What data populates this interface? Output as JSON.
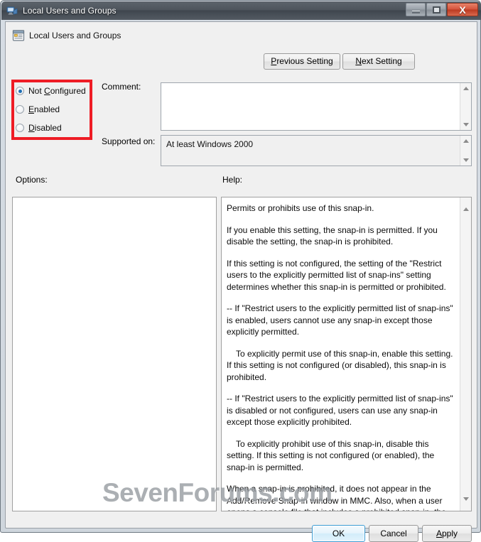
{
  "window": {
    "title": "Local Users and Groups",
    "title_icon": "mmc-snapin-icon",
    "controls": {
      "minimize_label": "Minimize",
      "maximize_label": "Maximize",
      "close_label": "X"
    }
  },
  "header": {
    "setting_name": "Local Users and Groups",
    "icon": "policy-setting-icon",
    "previous_button": "Previous Setting",
    "previous_accesskey": "P",
    "next_button": "Next Setting",
    "next_accesskey": "N"
  },
  "state": {
    "options": [
      {
        "label": "Not Configured",
        "accesskey": "C",
        "prefix": "Not ",
        "suffix": "onfigured",
        "selected": true
      },
      {
        "label": "Enabled",
        "accesskey": "E",
        "prefix": "",
        "suffix": "nabled",
        "selected": false
      },
      {
        "label": "Disabled",
        "accesskey": "D",
        "prefix": "",
        "suffix": "isabled",
        "selected": false
      }
    ],
    "highlight_color": "#ee1c25"
  },
  "comment": {
    "label": "Comment:",
    "value": "",
    "placeholder": ""
  },
  "supported": {
    "label": "Supported on:",
    "value": "At least Windows 2000"
  },
  "panels": {
    "options_label": "Options:",
    "help_label": "Help:",
    "options_content": ""
  },
  "help": {
    "paragraphs": [
      {
        "text": "Permits or prohibits use of this snap-in.",
        "indent": false
      },
      {
        "text": "If you enable this setting, the snap-in is permitted. If you disable the setting, the snap-in is prohibited.",
        "indent": false
      },
      {
        "text": "If this setting is not configured, the setting of the \"Restrict users to the explicitly permitted list of snap-ins\" setting determines whether this snap-in is permitted or prohibited.",
        "indent": false
      },
      {
        "text": "-- If \"Restrict users to the explicitly permitted list of snap-ins\" is enabled, users cannot use any snap-in except those explicitly permitted.",
        "indent": false
      },
      {
        "text": "To explicitly permit use of this snap-in, enable this setting. If this setting is not configured (or disabled), this snap-in is prohibited.",
        "indent": true
      },
      {
        "text": "-- If \"Restrict users to the explicitly permitted list of snap-ins\" is disabled or not configured, users can use any snap-in except those explicitly prohibited.",
        "indent": false
      },
      {
        "text": "To explicitly prohibit use of this snap-in, disable this setting. If this setting is not configured (or enabled), the snap-in is permitted.",
        "indent": true
      },
      {
        "text": "When a snap-in is prohibited, it does not appear in the Add/Remove Snap-in window in MMC. Also, when a user opens a console file that includes a prohibited snap-in, the console file opens, but the prohibited snap-in does not appear.",
        "indent": false
      }
    ]
  },
  "footer": {
    "ok": "OK",
    "cancel": "Cancel",
    "apply": "Apply",
    "apply_accesskey": "A"
  },
  "watermark": {
    "text": "SevenForums.com"
  }
}
